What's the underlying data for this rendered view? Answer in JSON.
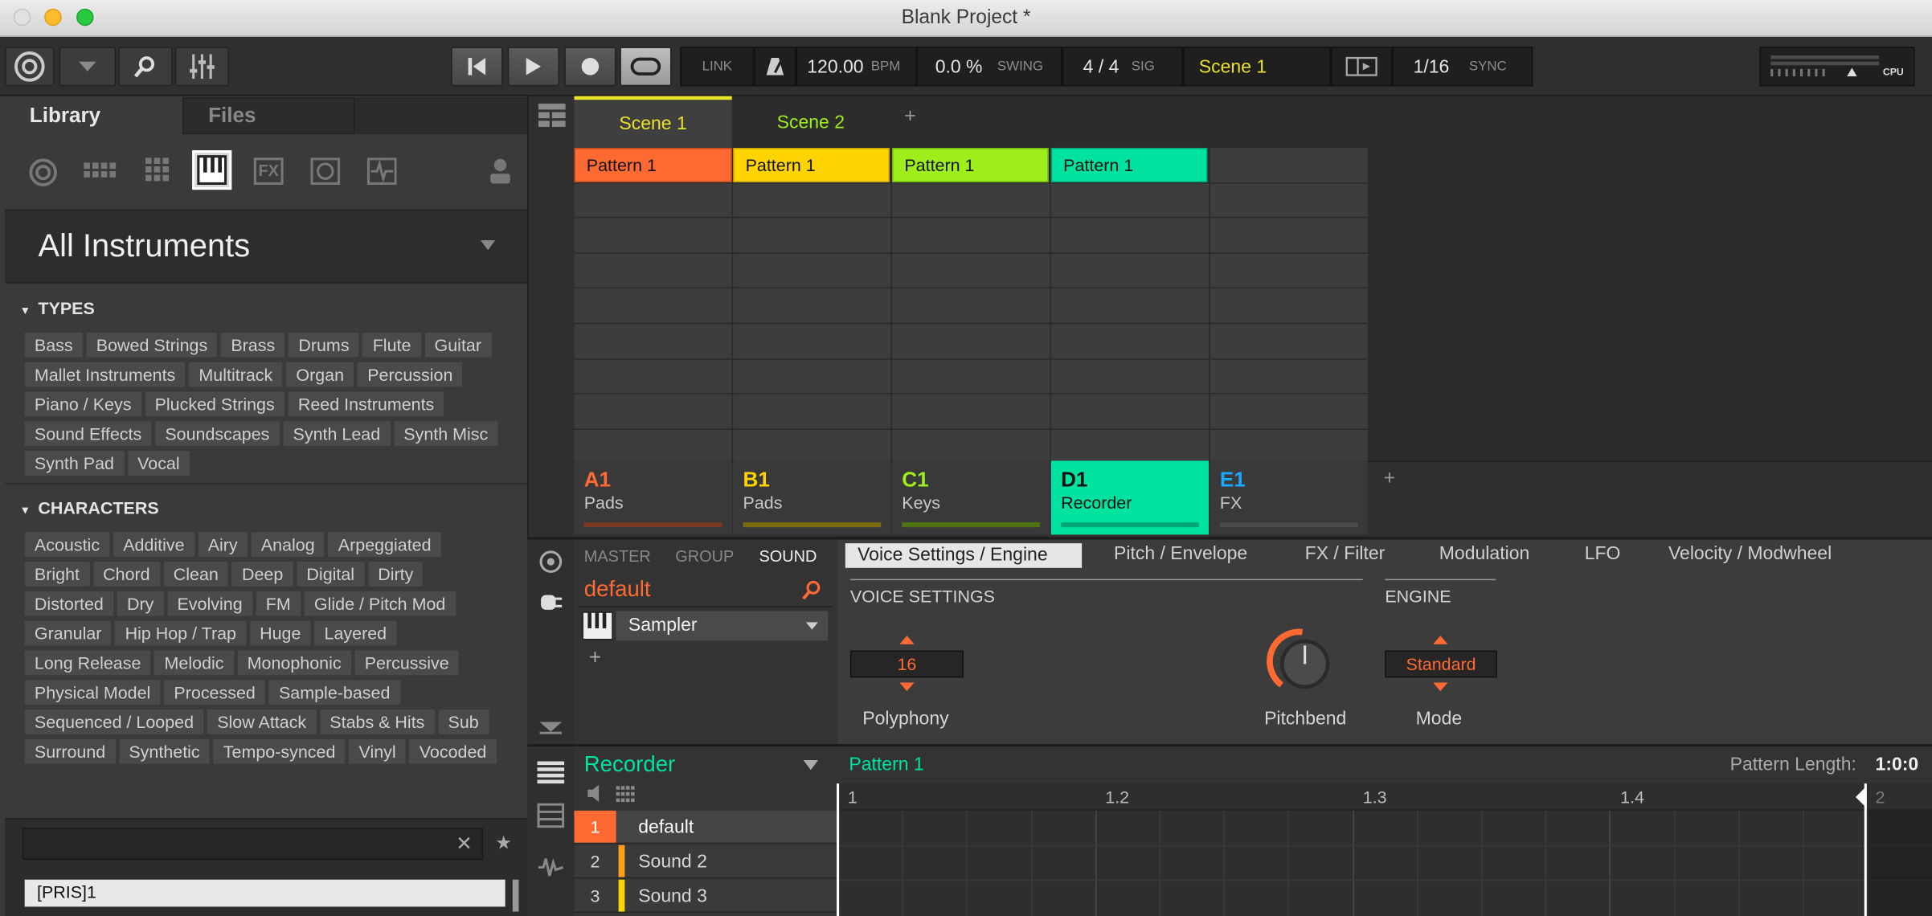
{
  "window": {
    "title": "Blank Project *"
  },
  "colors": {
    "orange": "#ff6a32",
    "yellow": "#ffd400",
    "lime": "#9dee1a",
    "teal": "#00e2a0",
    "blue": "#19a8ff",
    "accent": "#e9e12a"
  },
  "transport": {
    "link": "LINK",
    "tempo": "120.00",
    "tempo_unit": "BPM",
    "swing": "0.0 %",
    "swing_label": "SWING",
    "sig": "4 / 4",
    "sig_label": "SIG",
    "scene": "Scene 1",
    "quantize": "1/16",
    "sync": "SYNC",
    "cpu_label": "CPU"
  },
  "browser": {
    "tabs": [
      "Library",
      "Files"
    ],
    "category": "All Instruments",
    "types_label": "TYPES",
    "types": [
      "Bass",
      "Bowed Strings",
      "Brass",
      "Drums",
      "Flute",
      "Guitar",
      "Mallet Instruments",
      "Multitrack",
      "Organ",
      "Percussion",
      "Piano / Keys",
      "Plucked Strings",
      "Reed Instruments",
      "Sound Effects",
      "Soundscapes",
      "Synth Lead",
      "Synth Misc",
      "Synth Pad",
      "Vocal"
    ],
    "characters_label": "CHARACTERS",
    "characters": [
      "Acoustic",
      "Additive",
      "Airy",
      "Analog",
      "Arpeggiated",
      "Bright",
      "Chord",
      "Clean",
      "Deep",
      "Digital",
      "Dirty",
      "Distorted",
      "Dry",
      "Evolving",
      "FM",
      "Glide / Pitch Mod",
      "Granular",
      "Hip Hop / Trap",
      "Huge",
      "Layered",
      "Long Release",
      "Melodic",
      "Monophonic",
      "Percussive",
      "Physical Model",
      "Processed",
      "Sample-based",
      "Sequenced / Looped",
      "Slow Attack",
      "Stabs & Hits",
      "Sub",
      "Surround",
      "Synthetic",
      "Tempo-synced",
      "Vinyl",
      "Vocoded"
    ],
    "search_value": "",
    "result": "[PRIS]1"
  },
  "arranger": {
    "scenes": [
      "Scene 1",
      "Scene 2"
    ],
    "add": "+",
    "patterns": [
      "Pattern 1",
      "Pattern 1",
      "Pattern 1",
      "Pattern 1"
    ],
    "groups": [
      {
        "id": "A1",
        "name": "Pads"
      },
      {
        "id": "B1",
        "name": "Pads"
      },
      {
        "id": "C1",
        "name": "Keys"
      },
      {
        "id": "D1",
        "name": "Recorder"
      },
      {
        "id": "E1",
        "name": "FX"
      }
    ]
  },
  "control": {
    "tabs": [
      "MASTER",
      "GROUP",
      "SOUND"
    ],
    "preset": "default",
    "plugin": "Sampler",
    "add": "+",
    "page_tabs": [
      "Voice Settings / Engine",
      "Pitch / Envelope",
      "FX / Filter",
      "Modulation",
      "LFO",
      "Velocity / Modwheel"
    ],
    "voice_settings": "VOICE SETTINGS",
    "engine": "ENGINE",
    "polyphony_value": "16",
    "polyphony_label": "Polyphony",
    "pitchbend_label": "Pitchbend",
    "mode_value": "Standard",
    "mode_label": "Mode"
  },
  "pattern": {
    "group": "Recorder",
    "name": "Pattern 1",
    "length_label": "Pattern Length:",
    "length": "1:0:0",
    "ruler": [
      "1",
      "1.2",
      "1.3",
      "1.4",
      "2"
    ],
    "sounds": [
      {
        "n": "1",
        "name": "default"
      },
      {
        "n": "2",
        "name": "Sound 2"
      },
      {
        "n": "3",
        "name": "Sound 3"
      }
    ]
  }
}
